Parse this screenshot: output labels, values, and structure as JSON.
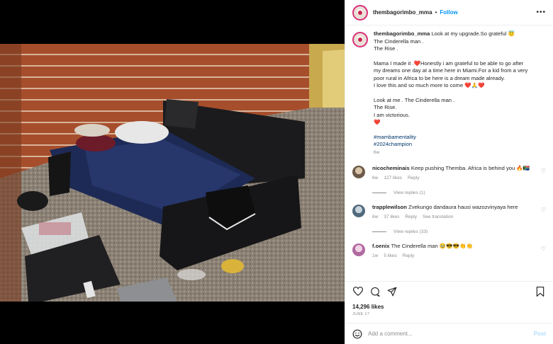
{
  "header": {
    "username": "thembagorimbo_mma",
    "separator": "•",
    "follow_label": "Follow",
    "more_label": "•••"
  },
  "caption": {
    "username": "thembagorimbo_mma",
    "lines": [
      "Look at my upgrade.So grateful 😇",
      "The Cinderella man .",
      "The Rise .",
      "Mama I made it .❤️Honestly i am grateful to be able to go after",
      "my dreams one day at a time here in Miami.For a kid from a very",
      "poor rural in Africa to be here is a dream made already.",
      "I love this and so much more to come ❤️🙏❤️",
      "Look at me . The Cinderella man .",
      "The Rise.",
      "I am victorious.",
      "❤️"
    ],
    "hashtags": [
      "#mambamentality",
      "#2024champion"
    ],
    "time": "6w"
  },
  "comments": [
    {
      "username": "nicocheminais",
      "text": "Keep pushing Themba. Africa is behind you 🔥🇿🇦",
      "time": "6w",
      "likes": "127 likes",
      "reply_label": "Reply",
      "extra": "",
      "view_replies": "View replies (1)"
    },
    {
      "username": "trapplewilson",
      "text": "Zvekungo dandaura hausi wazozvinyaya here",
      "time": "6w",
      "likes": "37 likes",
      "reply_label": "Reply",
      "extra": "See translation",
      "view_replies": "View replies (33)"
    },
    {
      "username": "f.oenix",
      "text": "The Cinderella man 🥹😎😎👏👏",
      "time": "1w",
      "likes": "5 likes",
      "reply_label": "Reply",
      "extra": "",
      "view_replies": ""
    }
  ],
  "actions": {
    "like_icon": "heart-outline",
    "comment_icon": "speech-bubble",
    "share_icon": "paper-plane",
    "save_icon": "bookmark"
  },
  "likes_count": "14,296 likes",
  "date": "JUNE 17",
  "composer": {
    "placeholder": "Add a comment...",
    "post_label": "Post"
  },
  "colors": {
    "accent": "#0095f6",
    "link": "#00376b",
    "muted": "#8e8e8e",
    "heart": "#ed1c24"
  }
}
